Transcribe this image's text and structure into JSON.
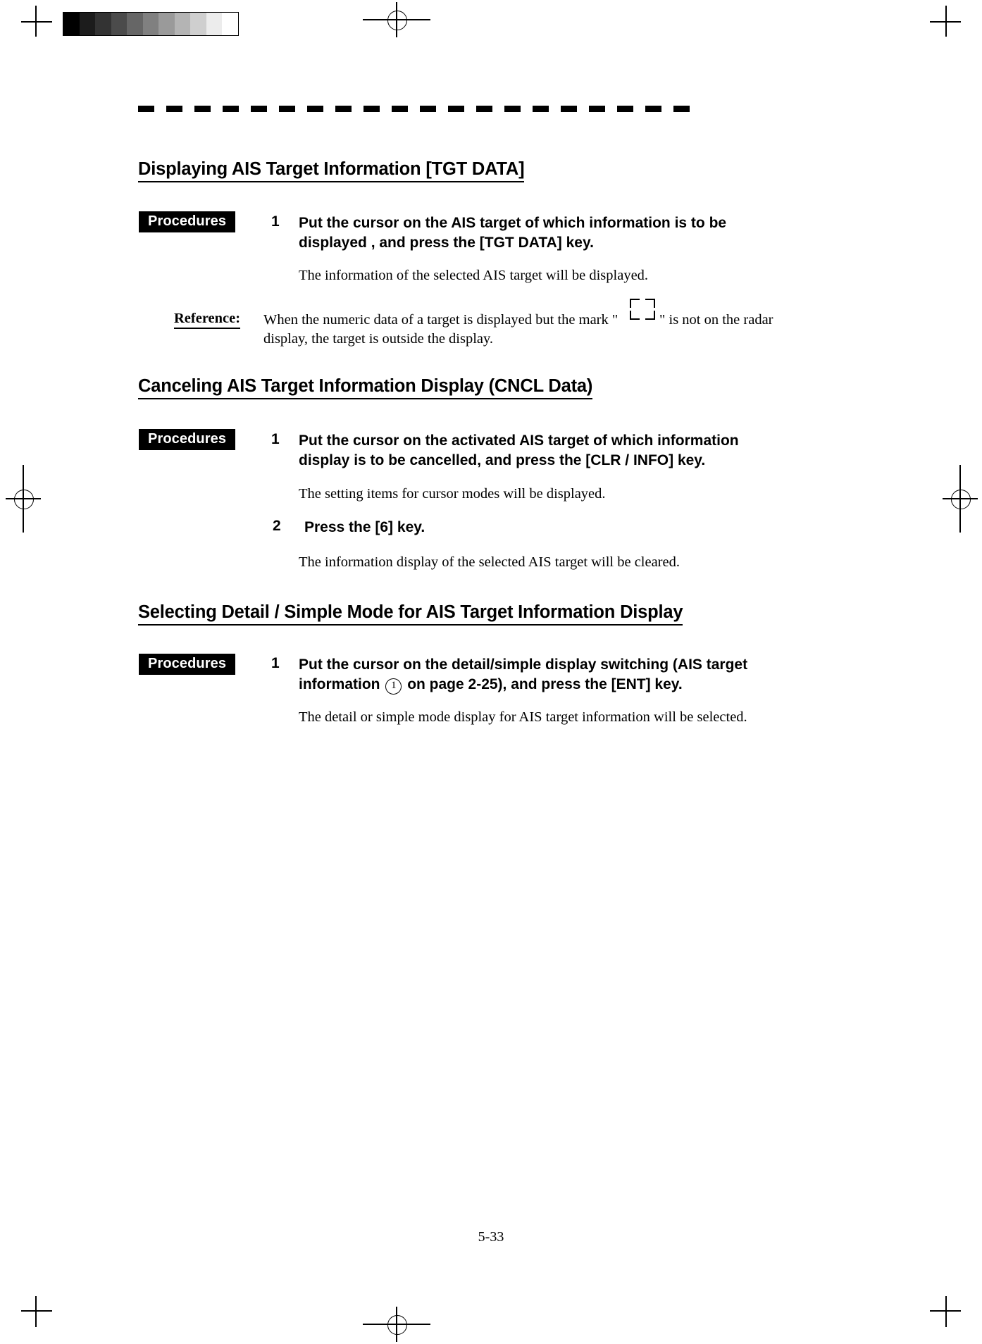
{
  "scan_artifacts": {
    "gray_strip_name": "grayscale-calibration-strip",
    "gray_steps": [
      "#000000",
      "#1c1c1c",
      "#333333",
      "#4b4b4b",
      "#666666",
      "#808080",
      "#9a9a9a",
      "#b4b4b4",
      "#cfcfcf",
      "#ececec",
      "#ffffff"
    ]
  },
  "page": {
    "number": "5-33"
  },
  "sections": [
    {
      "heading": "Displaying AIS Target Information [TGT DATA]",
      "badge": "Procedures",
      "steps": [
        {
          "number": "1",
          "text": "Put the cursor on the AIS target of which information is to be\ndisplayed , and press the [TGT DATA] key.",
          "result": "The information of the selected AIS target will be displayed."
        }
      ],
      "reference": {
        "label": "Reference:",
        "text_before_mark": "When the numeric data of a target is displayed but the mark \"",
        "mark_name": "target-corner-bracket-mark",
        "text_after_mark": "\" is not on the radar",
        "line2": "display, the target is outside the display."
      }
    },
    {
      "heading": "Canceling AIS Target Information Display (CNCL Data)",
      "badge": "Procedures",
      "steps": [
        {
          "number": "1",
          "text": "Put the cursor on the activated AIS target of which information\ndisplay is to be cancelled, and press the [CLR / INFO] key.",
          "result": "The setting items for cursor modes will be displayed."
        },
        {
          "number": "2",
          "text": "Press the [6] key.",
          "result": "The information display of the selected AIS target will be cleared."
        }
      ]
    },
    {
      "heading": "Selecting Detail / Simple Mode for AIS Target Information Display",
      "badge": "Procedures",
      "steps": [
        {
          "number": "1",
          "text_part1": "Put the cursor on the detail/simple display switching (AIS target",
          "text_part2_before": "information",
          "circled_number": "1",
          "text_part2_after": "on page 2-25), and press the [ENT] key.",
          "result": "The detail or simple mode display for AIS target information will be selected."
        }
      ]
    }
  ]
}
